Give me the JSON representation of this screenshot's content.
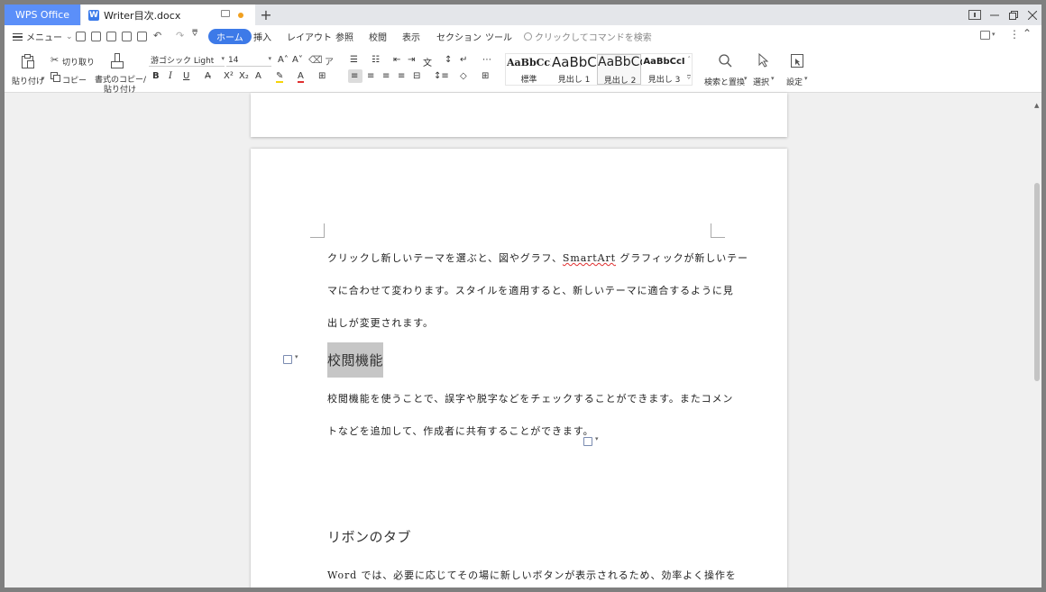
{
  "titlebar": {
    "home_tab": "WPS Office",
    "doc_tab": "Writer目次.docx",
    "doc_icon": "W"
  },
  "menu": {
    "menu_label": "メニュー",
    "tabs": [
      "ホーム",
      "挿入",
      "レイアウト",
      "参照",
      "校閲",
      "表示",
      "セクション",
      "ツール"
    ],
    "active_tab": "ホーム",
    "search_placeholder": "クリックしてコマンドを検索"
  },
  "ribbon": {
    "paste": "貼り付け",
    "cut": "切り取り",
    "copy": "コピー",
    "format_copy_line1": "書式のコピー/",
    "format_copy_line2": "貼り付け",
    "font_name": "游ゴシック Light",
    "font_size": "14",
    "bold": "B",
    "italic": "I",
    "underline": "U",
    "styles": [
      {
        "sample": "AaBbCcD",
        "name": "標準"
      },
      {
        "sample": "AaBbC",
        "name": "見出し 1"
      },
      {
        "sample": "AaBbCc",
        "name": "見出し 2"
      },
      {
        "sample": "AaBbCcI",
        "name": "見出し 3"
      }
    ],
    "find_replace": "検索と置換",
    "select": "選択",
    "settings": "設定"
  },
  "document": {
    "para1_line1_a": "クリックし新しいテーマを選ぶと、図やグラフ、",
    "para1_line1_b": "SmartArt",
    "para1_line1_c": " グラフィックが新しいテー",
    "para1_line2": "マに合わせて変わります。スタイルを適用すると、新しいテーマに適合するように見",
    "para1_line3": "出しが変更されます。",
    "heading1": "校閲機能",
    "para2_line1": "校閲機能を使うことで、誤字や脱字などをチェックすることができます。またコメン",
    "para2_line2": "トなどを追加して、作成者に共有することができます。",
    "heading2": "リボンのタブ",
    "para3_line1": "Word では、必要に応じてその場に新しいボタンが表示されるため、効率よく操作を"
  }
}
